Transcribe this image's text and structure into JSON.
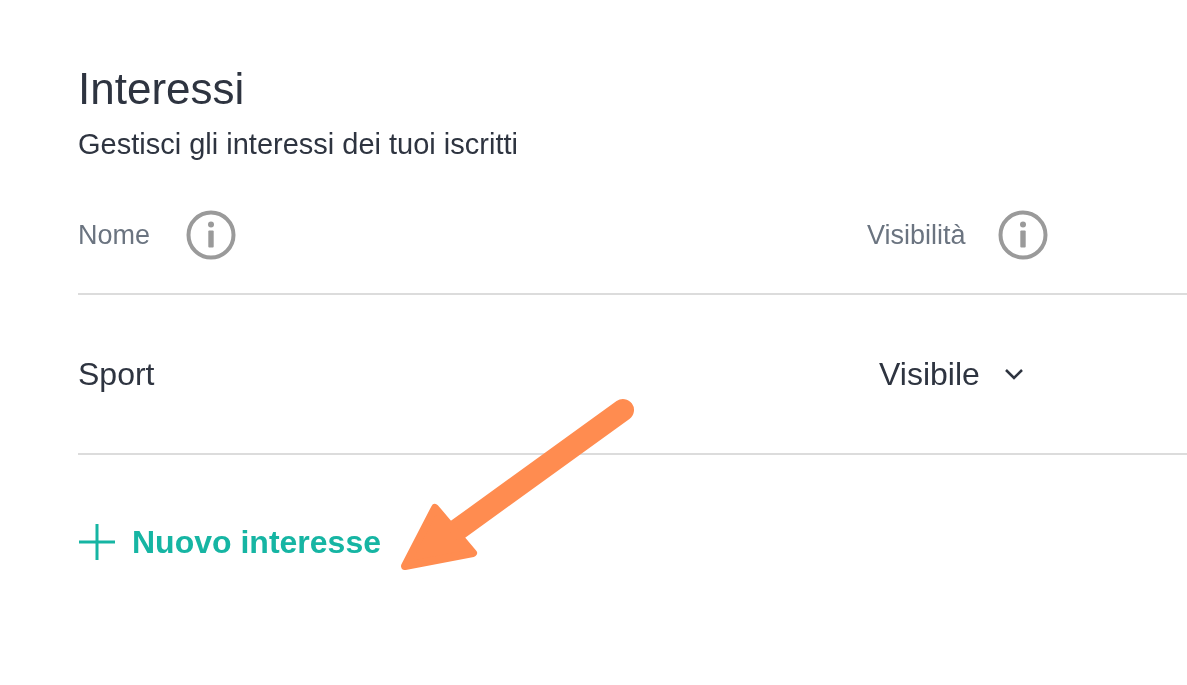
{
  "section": {
    "title": "Interessi",
    "subtitle": "Gestisci gli interessi dei tuoi iscritti"
  },
  "table": {
    "columns": [
      {
        "label": "Nome"
      },
      {
        "label": "Visibilità"
      }
    ],
    "rows": [
      {
        "name": "Sport",
        "visibility": "Visibile"
      }
    ]
  },
  "add_button": {
    "label": "Nuovo interesse"
  }
}
